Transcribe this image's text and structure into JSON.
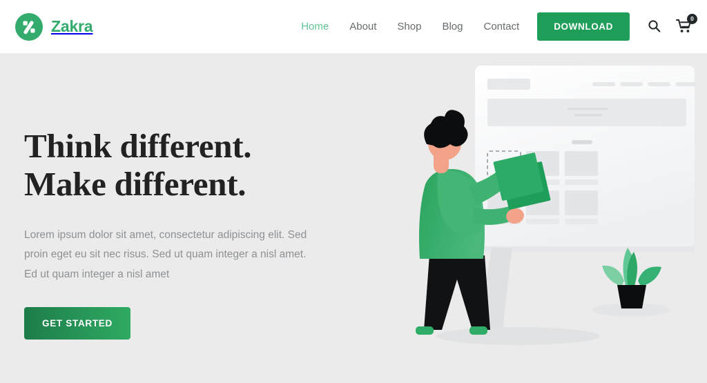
{
  "header": {
    "brand_name": "Zakra",
    "logo_icon": "zakra-percent-logo",
    "nav": [
      {
        "label": "Home",
        "active": true
      },
      {
        "label": "About",
        "active": false
      },
      {
        "label": "Shop",
        "active": false
      },
      {
        "label": "Blog",
        "active": false
      },
      {
        "label": "Contact",
        "active": false
      }
    ],
    "download_label": "DOWNLOAD",
    "search_icon": "search-icon",
    "cart_icon": "shopping-cart-icon",
    "cart_count": "0"
  },
  "hero": {
    "title_line1": "Think different.",
    "title_line2": "Make different.",
    "paragraph": "Lorem ipsum dolor sit amet, consectetur adipiscing elit. Sed proin eget eu sit nec risus. Sed ut quam integer a nisl amet.  Ed ut quam integer a nisl amet",
    "cta_label": "GET STARTED",
    "illustration": "person-placing-block-into-website-wireframe"
  },
  "colors": {
    "brand_green": "#32ab6d",
    "button_green": "#1f9e59",
    "cta_gradient_from": "#1d7d4a",
    "cta_gradient_to": "#2faa62",
    "nav_active": "#62c494",
    "nav_inactive": "#666b6e",
    "hero_background": "#ebebeb",
    "header_background": "#ffffff",
    "heading_text": "#222222",
    "body_text": "#8d9194",
    "badge_background": "#222729"
  }
}
